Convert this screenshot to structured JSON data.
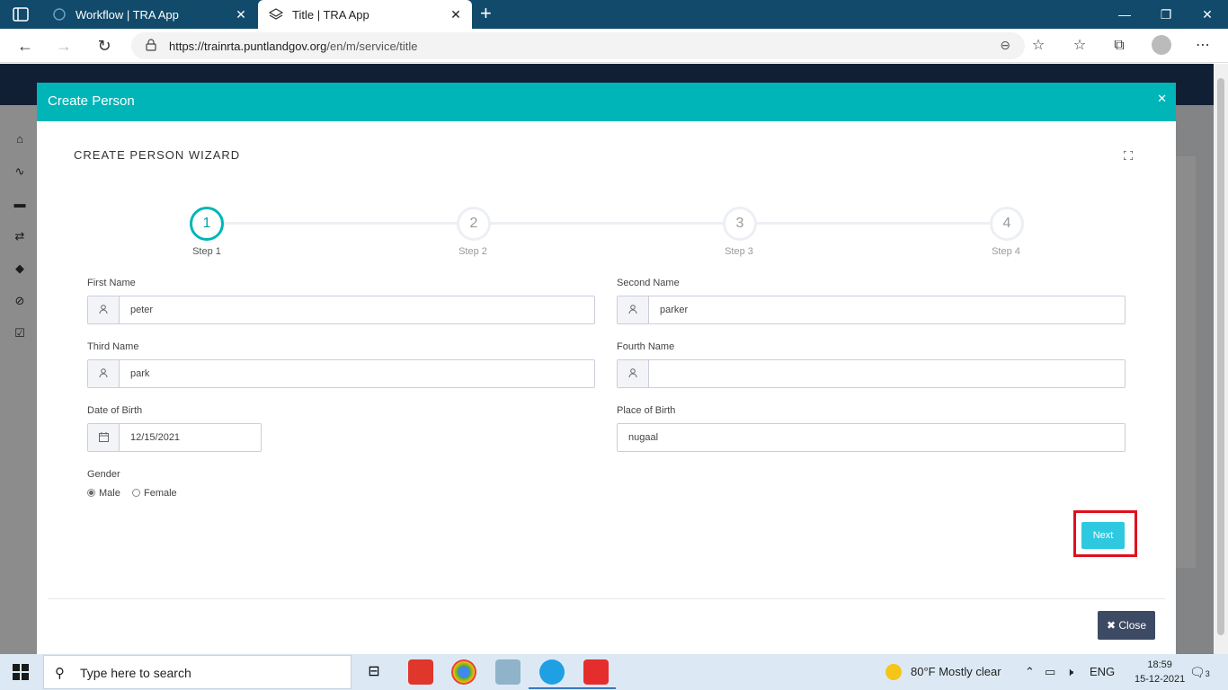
{
  "browser": {
    "tabs": [
      {
        "label": "Workflow | TRA App",
        "active": false
      },
      {
        "label": "Title | TRA App",
        "active": true
      }
    ],
    "url_host": "https://trainrta.puntlandgov.org",
    "url_path": "/en/m/service/title"
  },
  "modal": {
    "title": "Create Person",
    "wizard_title": "CREATE PERSON WIZARD",
    "steps": [
      {
        "number": "1",
        "label": "Step 1",
        "active": true
      },
      {
        "number": "2",
        "label": "Step 2",
        "active": false
      },
      {
        "number": "3",
        "label": "Step 3",
        "active": false
      },
      {
        "number": "4",
        "label": "Step 4",
        "active": false
      }
    ],
    "fields": {
      "first_name": {
        "label": "First Name",
        "value": "peter"
      },
      "second_name": {
        "label": "Second Name",
        "value": "parker"
      },
      "third_name": {
        "label": "Third Name",
        "value": "park"
      },
      "fourth_name": {
        "label": "Fourth Name",
        "value": ""
      },
      "date_of_birth": {
        "label": "Date of Birth",
        "value": "12/15/2021"
      },
      "place_of_birth": {
        "label": "Place of Birth",
        "value": "nugaal"
      }
    },
    "gender": {
      "label": "Gender",
      "options": [
        "Male",
        "Female"
      ],
      "selected": "Male"
    },
    "next_label": "Next",
    "close_label": "Close"
  },
  "taskbar": {
    "search_placeholder": "Type here to search",
    "weather": "80°F  Mostly clear",
    "language": "ENG",
    "time": "18:59",
    "date": "15-12-2021",
    "notification_count": "3"
  },
  "colors": {
    "accent": "#00b5b8",
    "next_button": "#2ec9e0",
    "close_button": "#3d4a63",
    "highlight": "#e0101c"
  }
}
